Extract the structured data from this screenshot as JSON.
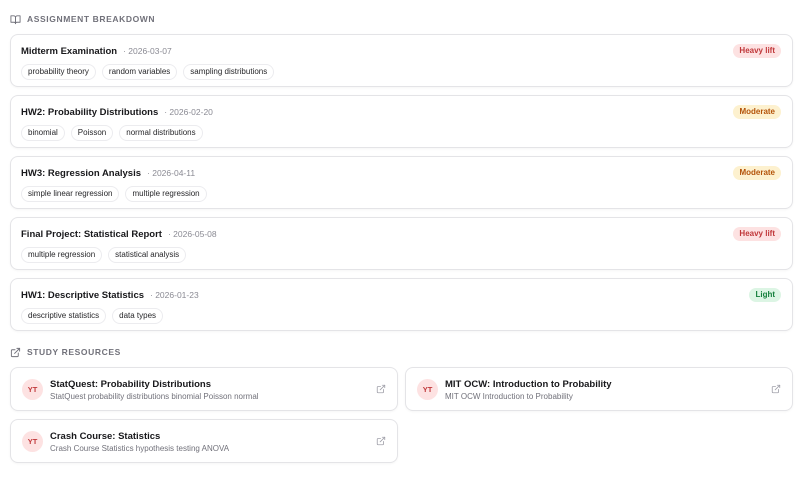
{
  "assignments_section": {
    "title": "ASSIGNMENT BREAKDOWN",
    "icon": "book-open-icon"
  },
  "assignments": [
    {
      "title": "Midterm Examination",
      "date": "· 2026-03-07",
      "tags": [
        "probability theory",
        "random variables",
        "sampling distributions"
      ],
      "load": "Heavy lift",
      "load_level": "heavy"
    },
    {
      "title": "HW2: Probability Distributions",
      "date": "· 2026-02-20",
      "tags": [
        "binomial",
        "Poisson",
        "normal distributions"
      ],
      "load": "Moderate",
      "load_level": "moderate"
    },
    {
      "title": "HW3: Regression Analysis",
      "date": "· 2026-04-11",
      "tags": [
        "simple linear regression",
        "multiple regression"
      ],
      "load": "Moderate",
      "load_level": "moderate"
    },
    {
      "title": "Final Project: Statistical Report",
      "date": "· 2026-05-08",
      "tags": [
        "multiple regression",
        "statistical analysis"
      ],
      "load": "Heavy lift",
      "load_level": "heavy"
    },
    {
      "title": "HW1: Descriptive Statistics",
      "date": "· 2026-01-23",
      "tags": [
        "descriptive statistics",
        "data types"
      ],
      "load": "Light",
      "load_level": "light"
    }
  ],
  "resources_section": {
    "title": "STUDY RESOURCES",
    "icon": "external-link-icon"
  },
  "resources": [
    {
      "badge": "YT",
      "title": "StatQuest: Probability Distributions",
      "description": "StatQuest probability distributions binomial Poisson normal"
    },
    {
      "badge": "YT",
      "title": "MIT OCW: Introduction to Probability",
      "description": "MIT OCW Introduction to Probability"
    },
    {
      "badge": "YT",
      "title": "Crash Course: Statistics",
      "description": "Crash Course Statistics hypothesis testing ANOVA"
    }
  ],
  "colors": {
    "heavy": "#c0383a",
    "moderate": "#b45309",
    "light": "#15803d",
    "youtube_badge": "#c0383a"
  }
}
